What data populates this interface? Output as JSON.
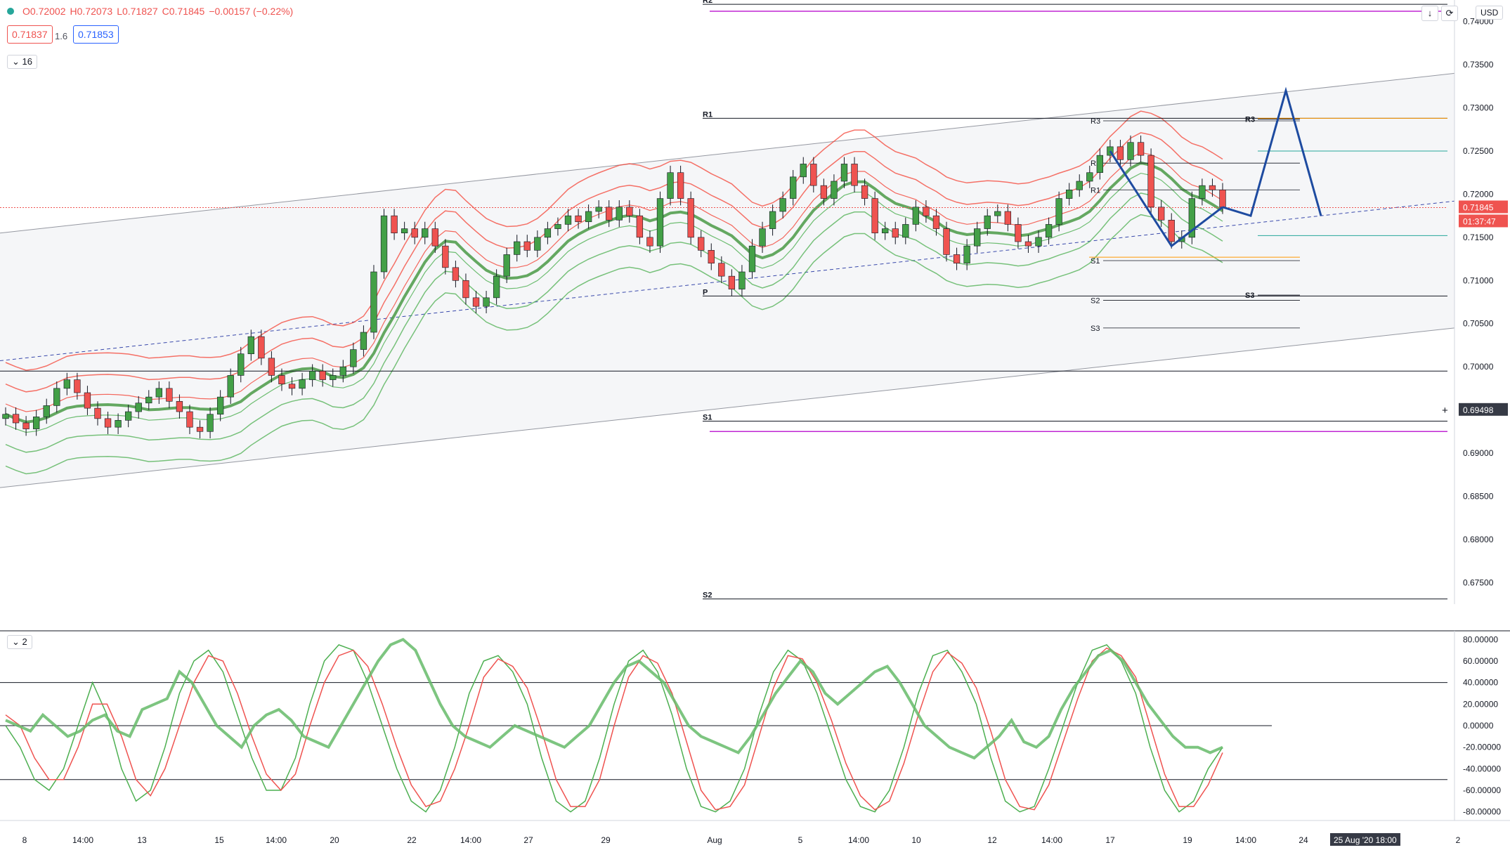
{
  "legend": {
    "open": "O0.72002",
    "high": "H0.72073",
    "low": "L0.71827",
    "close": "C0.71845",
    "change": "−0.00157 (−0.22%)"
  },
  "bid": "0.71837",
  "spread": "1.6",
  "ask": "0.71853",
  "main_collapse": "16",
  "osc_collapse": "2",
  "currency": "USD",
  "colors": {
    "up": "#43a047",
    "down": "#ef5350",
    "channel": "#9598a1",
    "envelope_red": "#f44336",
    "envelope_green": "#4caf50",
    "projection": "#1e4ba0",
    "pivot_magenta": "#c026d3"
  },
  "chart_data": {
    "type": "candlestick",
    "price_axis": {
      "range": [
        0.6725,
        0.7425
      ],
      "ticks": [
        "0.74000",
        "0.73500",
        "0.73000",
        "0.72500",
        "0.72000",
        "0.71500",
        "0.71000",
        "0.70500",
        "0.70000",
        "0.69500",
        "0.69000",
        "0.68500",
        "0.68000",
        "0.67500"
      ]
    },
    "time_axis": [
      "8",
      "14:00",
      "13",
      "15",
      "14:00",
      "20",
      "22",
      "14:00",
      "27",
      "29",
      "Aug",
      "5",
      "14:00",
      "10",
      "12",
      "14:00",
      "17",
      "19",
      "14:00",
      "24",
      "2"
    ],
    "current_price": {
      "value": 0.71845,
      "label": "0.71845",
      "countdown": "01:37:47"
    },
    "crosshair": {
      "value": 0.69498,
      "label": "0.69498",
      "time_label": "25 Aug '20   18:00"
    },
    "pivot_levels": [
      {
        "label": "R2",
        "value": 0.742
      },
      {
        "label": "R1",
        "value": 0.7288
      },
      {
        "label": "P",
        "value": 0.7082
      },
      {
        "label": "S1",
        "value": 0.6937
      },
      {
        "label": "S2",
        "value": 0.6731
      }
    ],
    "weekly_levels": [
      {
        "label": "R3",
        "value": 0.7285
      },
      {
        "label": "R2",
        "value": 0.7236
      },
      {
        "label": "R1",
        "value": 0.7205
      },
      {
        "label": "S1",
        "value": 0.7123
      },
      {
        "label": "S2",
        "value": 0.7077
      },
      {
        "label": "S3",
        "value": 0.7045
      }
    ],
    "right_levels": [
      {
        "label": "R3",
        "value": 0.7287
      },
      {
        "label": "S3",
        "value": 0.7083
      }
    ],
    "horizontal_level": 0.6995,
    "closes": [
      0.6945,
      0.6935,
      0.6928,
      0.6942,
      0.6955,
      0.6975,
      0.6985,
      0.697,
      0.6952,
      0.694,
      0.693,
      0.6938,
      0.6948,
      0.6958,
      0.6965,
      0.6975,
      0.696,
      0.6948,
      0.693,
      0.6925,
      0.6945,
      0.6965,
      0.699,
      0.7015,
      0.7035,
      0.701,
      0.699,
      0.698,
      0.6975,
      0.6985,
      0.6995,
      0.6985,
      0.699,
      0.7,
      0.702,
      0.704,
      0.711,
      0.7175,
      0.7155,
      0.716,
      0.715,
      0.716,
      0.714,
      0.7115,
      0.71,
      0.708,
      0.707,
      0.708,
      0.7105,
      0.713,
      0.7145,
      0.7135,
      0.715,
      0.716,
      0.7165,
      0.7175,
      0.7168,
      0.718,
      0.7185,
      0.717,
      0.7185,
      0.7175,
      0.715,
      0.714,
      0.7195,
      0.7225,
      0.7195,
      0.715,
      0.7135,
      0.712,
      0.7105,
      0.709,
      0.711,
      0.714,
      0.716,
      0.718,
      0.7195,
      0.722,
      0.7235,
      0.721,
      0.7195,
      0.7215,
      0.7235,
      0.721,
      0.7195,
      0.7155,
      0.716,
      0.715,
      0.7165,
      0.7185,
      0.7175,
      0.716,
      0.713,
      0.712,
      0.714,
      0.716,
      0.7175,
      0.718,
      0.7165,
      0.7145,
      0.714,
      0.715,
      0.7165,
      0.7195,
      0.7205,
      0.7215,
      0.7225,
      0.7245,
      0.7255,
      0.724,
      0.726,
      0.7245,
      0.7185,
      0.717,
      0.7145,
      0.715,
      0.7195,
      0.721,
      0.7205,
      0.7185
    ],
    "oscillator": {
      "axis_ticks": [
        "80.00000",
        "60.00000",
        "40.00000",
        "20.00000",
        "0.00000",
        "-20.00000",
        "-40.00000",
        "-60.00000",
        "-80.00000"
      ],
      "range": [
        -88,
        88
      ],
      "levels": [
        40,
        0,
        -50
      ],
      "main_line": [
        5,
        0,
        -5,
        10,
        0,
        -10,
        -5,
        5,
        10,
        -5,
        -10,
        15,
        20,
        25,
        50,
        40,
        20,
        0,
        -10,
        -20,
        0,
        10,
        15,
        5,
        -10,
        -15,
        -20,
        0,
        20,
        40,
        60,
        75,
        80,
        70,
        45,
        20,
        0,
        -10,
        -15,
        -20,
        -10,
        0,
        -5,
        -10,
        -15,
        -20,
        -10,
        0,
        20,
        40,
        55,
        60,
        50,
        40,
        20,
        0,
        -10,
        -15,
        -20,
        -25,
        -10,
        10,
        30,
        45,
        60,
        50,
        30,
        20,
        30,
        40,
        50,
        55,
        40,
        20,
        0,
        -10,
        -20,
        -25,
        -30,
        -20,
        -10,
        5,
        -15,
        -20,
        -10,
        15,
        35,
        50,
        65,
        70,
        60,
        40,
        20,
        5,
        -10,
        -20,
        -20,
        -25,
        -20
      ],
      "signal_fast": [
        0,
        -20,
        -50,
        -60,
        -40,
        0,
        40,
        10,
        -40,
        -70,
        -60,
        -20,
        30,
        60,
        70,
        50,
        10,
        -30,
        -60,
        -60,
        -30,
        20,
        60,
        75,
        70,
        40,
        0,
        -40,
        -70,
        -80,
        -60,
        -20,
        30,
        60,
        65,
        50,
        20,
        -30,
        -70,
        -80,
        -70,
        -30,
        20,
        60,
        70,
        50,
        10,
        -40,
        -75,
        -80,
        -70,
        -40,
        10,
        50,
        70,
        60,
        30,
        -10,
        -50,
        -75,
        -80,
        -60,
        -20,
        30,
        65,
        70,
        50,
        20,
        -30,
        -70,
        -80,
        -75,
        -40,
        0,
        40,
        70,
        75,
        60,
        30,
        -20,
        -60,
        -80,
        -70,
        -40,
        -20
      ],
      "signal_slow": [
        10,
        0,
        -30,
        -50,
        -50,
        -20,
        20,
        20,
        -10,
        -50,
        -65,
        -40,
        0,
        40,
        65,
        60,
        30,
        -10,
        -45,
        -60,
        -45,
        0,
        40,
        65,
        70,
        55,
        20,
        -20,
        -55,
        -75,
        -70,
        -40,
        0,
        45,
        62,
        55,
        35,
        -5,
        -50,
        -75,
        -75,
        -50,
        0,
        45,
        65,
        58,
        30,
        -15,
        -60,
        -78,
        -75,
        -55,
        -10,
        35,
        65,
        62,
        40,
        5,
        -35,
        -65,
        -78,
        -70,
        -35,
        10,
        50,
        68,
        58,
        35,
        -5,
        -50,
        -75,
        -78,
        -55,
        -15,
        25,
        60,
        72,
        65,
        45,
        0,
        -45,
        -75,
        -75,
        -55,
        -25
      ]
    },
    "projection": [
      [
        0.7185,
        0.7175
      ],
      [
        0.732,
        0.7175
      ]
    ]
  }
}
